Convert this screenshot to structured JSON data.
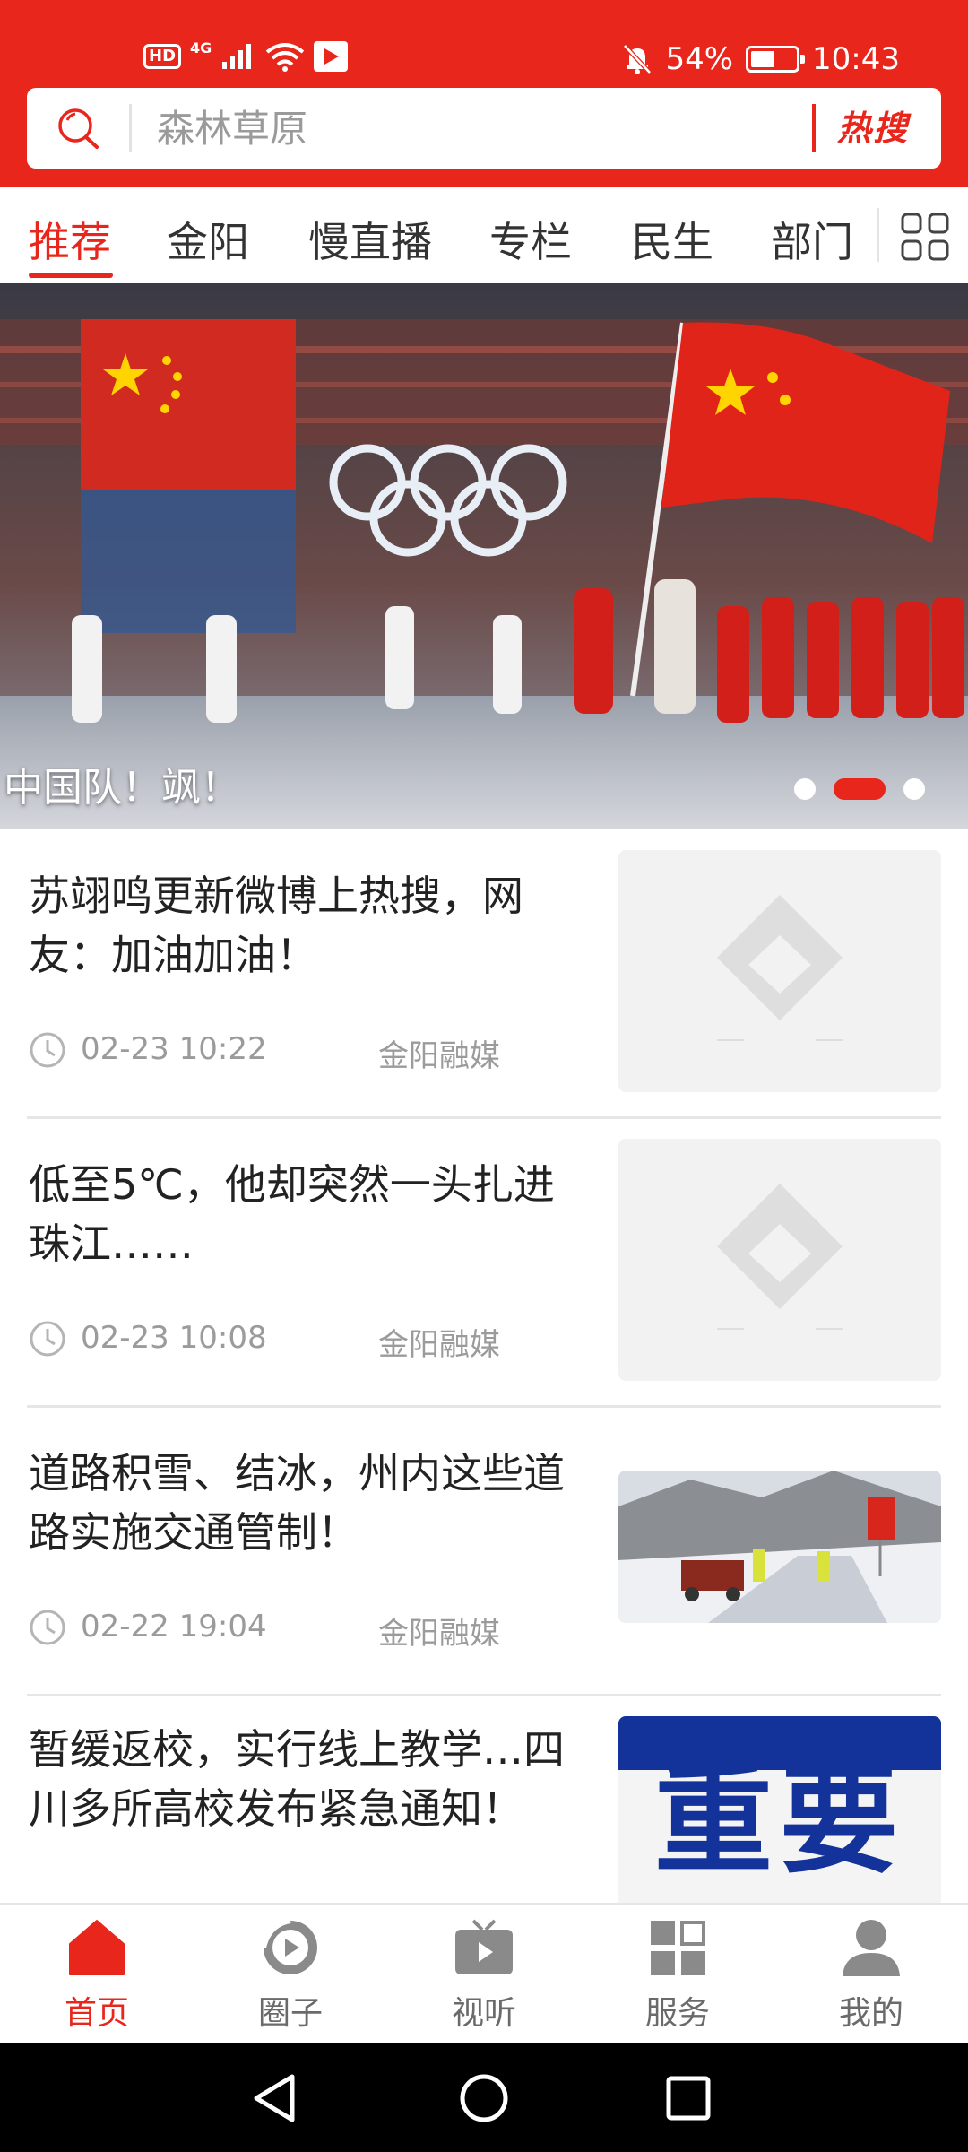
{
  "status_bar": {
    "net_type": "4G",
    "hd_label": "HD",
    "battery_percent": "54%",
    "battery_level": 0.54,
    "time": "10:43"
  },
  "search": {
    "placeholder": "森林草原",
    "hot_label": "热搜"
  },
  "tabs": [
    {
      "label": "推荐",
      "active": true
    },
    {
      "label": "金阳",
      "active": false
    },
    {
      "label": "慢直播",
      "active": false
    },
    {
      "label": "专栏",
      "active": false
    },
    {
      "label": "民生",
      "active": false
    },
    {
      "label": "部门",
      "active": false
    }
  ],
  "hero": {
    "caption": "中国队！飒！",
    "slide_count": 3,
    "active_slide": 2
  },
  "news": [
    {
      "title": "苏翊鸣更新微博上热搜，网友：加油加油！",
      "time": "02-23 10:22",
      "source": "金阳融媒",
      "thumb": "placeholder-logo"
    },
    {
      "title": "低至5℃，他却突然一头扎进珠江……",
      "time": "02-23 10:08",
      "source": "金阳融媒",
      "thumb": "placeholder-logo"
    },
    {
      "title": "道路积雪、结冰，州内这些道路实施交通管制！",
      "time": "02-22 19:04",
      "source": "金阳融媒",
      "thumb": "snow-road-photo"
    },
    {
      "title": "暂缓返校，实行线上教学…四川多所高校发布紧急通知！",
      "time": "",
      "source": "",
      "thumb": "important-banner",
      "thumb_text": "重要"
    }
  ],
  "bottom_nav": [
    {
      "label": "首页",
      "icon": "home-icon",
      "active": true
    },
    {
      "label": "圈子",
      "icon": "circle-icon",
      "active": false
    },
    {
      "label": "视听",
      "icon": "tv-icon",
      "active": false
    },
    {
      "label": "服务",
      "icon": "services-grid-icon",
      "active": false
    },
    {
      "label": "我的",
      "icon": "profile-icon",
      "active": false
    }
  ],
  "colors": {
    "brand_red": "#e8261c",
    "inactive_gray": "#6a6a6a",
    "meta_gray": "#9b9b9b"
  }
}
